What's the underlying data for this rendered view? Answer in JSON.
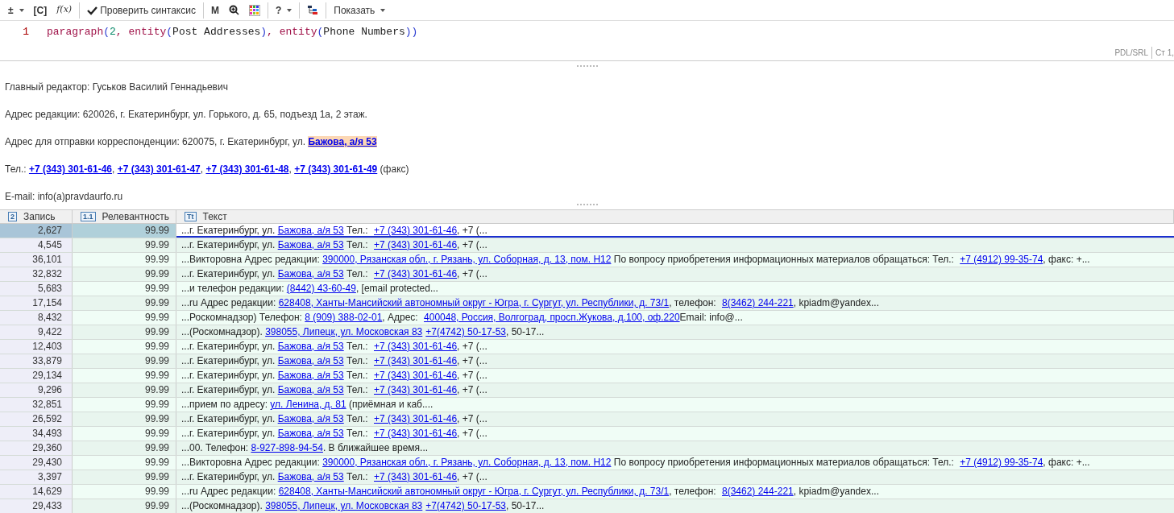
{
  "toolbar": [
    {
      "kind": "text",
      "label": "±",
      "caret": true
    },
    {
      "kind": "text",
      "label": "[C]",
      "caret": false
    },
    {
      "kind": "italic",
      "label": "f(x)",
      "caret": false
    },
    {
      "kind": "sep"
    },
    {
      "kind": "check",
      "label": "Проверить синтаксис",
      "caret": false
    },
    {
      "kind": "sep"
    },
    {
      "kind": "text",
      "label": "M",
      "caret": false
    },
    {
      "kind": "zoom",
      "caret": false
    },
    {
      "kind": "grid",
      "caret": false
    },
    {
      "kind": "sep"
    },
    {
      "kind": "text",
      "label": "?",
      "caret": true
    },
    {
      "kind": "sep"
    },
    {
      "kind": "tree",
      "caret": false
    },
    {
      "kind": "sep"
    },
    {
      "kind": "text",
      "label": "Показать",
      "caret": true
    }
  ],
  "editor": {
    "line_number": "1",
    "tokens": [
      {
        "kind": "function",
        "text": "paragraph"
      },
      {
        "kind": "paren",
        "text": "("
      },
      {
        "kind": "number",
        "text": "2"
      },
      {
        "kind": "function",
        "text": ", entity"
      },
      {
        "kind": "paren",
        "text": "("
      },
      {
        "kind": "plain",
        "text": "Post Addresses"
      },
      {
        "kind": "paren",
        "text": ")"
      },
      {
        "kind": "function",
        "text": ", entity"
      },
      {
        "kind": "paren",
        "text": "("
      },
      {
        "kind": "plain",
        "text": "Phone Numbers"
      },
      {
        "kind": "paren",
        "text": "))"
      }
    ],
    "status": [
      "PDL/SRL",
      "Ст 1,"
    ]
  },
  "preview": [
    [
      {
        "text": "Главный редактор: Гуськов Василий Геннадьевич",
        "kind": "text"
      }
    ],
    [
      {
        "text": "Адрес редакции: 620026, г. Екатеринбург, ул. Горького, д. 65, подъезд 1а, 2 этаж.",
        "kind": "text"
      }
    ],
    [
      {
        "text": "Адрес для отправки корреспонденции: 620075, г. Екатеринбург, ул. ",
        "kind": "text"
      },
      {
        "text": "Бажова, а/я 53",
        "kind": "highlight"
      }
    ],
    [
      {
        "text": "Тел.: ",
        "kind": "text"
      },
      {
        "text": "+7 (343) 301-61-46",
        "kind": "link"
      },
      {
        "text": ", ",
        "kind": "text"
      },
      {
        "text": "+7 (343) 301-61-47",
        "kind": "link"
      },
      {
        "text": ", ",
        "kind": "text"
      },
      {
        "text": "+7 (343) 301-61-48",
        "kind": "link"
      },
      {
        "text": ", ",
        "kind": "text"
      },
      {
        "text": "+7 (343) 301-61-49",
        "kind": "link"
      },
      {
        "text": " (факс)",
        "kind": "text"
      }
    ],
    [
      {
        "text": "E-mail: info(a)pravdaurfo.ru",
        "kind": "text"
      }
    ]
  ],
  "table": {
    "columns": [
      {
        "icon": "2",
        "label": "Запись"
      },
      {
        "icon": "1.1",
        "label": "Релевантность"
      },
      {
        "icon": "Tt",
        "label": "Текст"
      }
    ],
    "rows": [
      {
        "record": "2,627",
        "relevance": "99.99",
        "selected": true,
        "text": [
          {
            "text": "...г. Екатеринбург, ул. ",
            "kind": "text"
          },
          {
            "text": "Бажова, а/я 53",
            "kind": "link"
          },
          {
            "text": " Тел.: ",
            "kind": "text"
          },
          {
            "text": "+7 (343) 301-61-46",
            "kind": "link"
          },
          {
            "text": ", +7 (...",
            "kind": "text"
          }
        ]
      },
      {
        "record": "4,545",
        "relevance": "99.99",
        "selected": false,
        "text": [
          {
            "text": "...г. Екатеринбург, ул. ",
            "kind": "text"
          },
          {
            "text": "Бажова, а/я 53",
            "kind": "link"
          },
          {
            "text": " Тел.: ",
            "kind": "text"
          },
          {
            "text": "+7 (343) 301-61-46",
            "kind": "link"
          },
          {
            "text": ", +7 (...",
            "kind": "text"
          }
        ]
      },
      {
        "record": "36,101",
        "relevance": "99.99",
        "selected": false,
        "text": [
          {
            "text": "...Викторовна Адрес редакции: ",
            "kind": "text"
          },
          {
            "text": "390000, Рязанская обл., г. Рязань, ул. Соборная, д. 13, пом. Н12",
            "kind": "link"
          },
          {
            "text": " По вопросу приобретения информационных материалов обращаться: Тел.: ",
            "kind": "text"
          },
          {
            "text": "+7 (4912) 99-35-74",
            "kind": "link"
          },
          {
            "text": ", факс: +...",
            "kind": "text"
          }
        ]
      },
      {
        "record": "32,832",
        "relevance": "99.99",
        "selected": false,
        "text": [
          {
            "text": "...г. Екатеринбург, ул. ",
            "kind": "text"
          },
          {
            "text": "Бажова, а/я 53",
            "kind": "link"
          },
          {
            "text": " Тел.: ",
            "kind": "text"
          },
          {
            "text": "+7 (343) 301-61-46",
            "kind": "link"
          },
          {
            "text": ", +7 (...",
            "kind": "text"
          }
        ]
      },
      {
        "record": "5,683",
        "relevance": "99.99",
        "selected": false,
        "text": [
          {
            "text": "...и телефон редакции: ",
            "kind": "text"
          },
          {
            "text": "(8442) 43-60-49",
            "kind": "link"
          },
          {
            "text": ", [email protected...",
            "kind": "text"
          }
        ]
      },
      {
        "record": "17,154",
        "relevance": "99.99",
        "selected": false,
        "text": [
          {
            "text": "...ru Адрес редакции: ",
            "kind": "text"
          },
          {
            "text": "628408, Ханты-Мансийский автономный округ - Югра, г. Сургут, ул. Республики, д. 73/1",
            "kind": "link"
          },
          {
            "text": ", телефон: ",
            "kind": "text"
          },
          {
            "text": "8(3462) 244-221",
            "kind": "link"
          },
          {
            "text": ", kpiadm@yandex...",
            "kind": "text"
          }
        ]
      },
      {
        "record": "8,432",
        "relevance": "99.99",
        "selected": false,
        "text": [
          {
            "text": "...Роскомнадзор) Телефон: ",
            "kind": "text"
          },
          {
            "text": "8 (909) 388-02-01",
            "kind": "link"
          },
          {
            "text": ", Адрес: ",
            "kind": "text"
          },
          {
            "text": "400048, Россия, Волгоград, просп.Жукова, д.100, оф.220",
            "kind": "link"
          },
          {
            "text": "Email: info@...",
            "kind": "text"
          }
        ]
      },
      {
        "record": "9,422",
        "relevance": "99.99",
        "selected": false,
        "text": [
          {
            "text": "...(Роскомнадзор). ",
            "kind": "text"
          },
          {
            "text": "398055, Липецк, ул. Московская 83",
            "kind": "link"
          },
          {
            "text": "+7(4742) 50-17-53",
            "kind": "link"
          },
          {
            "text": ", 50-17...",
            "kind": "text"
          }
        ]
      },
      {
        "record": "12,403",
        "relevance": "99.99",
        "selected": false,
        "text": [
          {
            "text": "...г. Екатеринбург, ул. ",
            "kind": "text"
          },
          {
            "text": "Бажова, а/я 53",
            "kind": "link"
          },
          {
            "text": " Тел.: ",
            "kind": "text"
          },
          {
            "text": "+7 (343) 301-61-46",
            "kind": "link"
          },
          {
            "text": ", +7 (...",
            "kind": "text"
          }
        ]
      },
      {
        "record": "33,879",
        "relevance": "99.99",
        "selected": false,
        "text": [
          {
            "text": "...г. Екатеринбург, ул. ",
            "kind": "text"
          },
          {
            "text": "Бажова, а/я 53",
            "kind": "link"
          },
          {
            "text": " Тел.: ",
            "kind": "text"
          },
          {
            "text": "+7 (343) 301-61-46",
            "kind": "link"
          },
          {
            "text": ", +7 (...",
            "kind": "text"
          }
        ]
      },
      {
        "record": "29,134",
        "relevance": "99.99",
        "selected": false,
        "text": [
          {
            "text": "...г. Екатеринбург, ул. ",
            "kind": "text"
          },
          {
            "text": "Бажова, а/я 53",
            "kind": "link"
          },
          {
            "text": " Тел.: ",
            "kind": "text"
          },
          {
            "text": "+7 (343) 301-61-46",
            "kind": "link"
          },
          {
            "text": ", +7 (...",
            "kind": "text"
          }
        ]
      },
      {
        "record": "9,296",
        "relevance": "99.99",
        "selected": false,
        "text": [
          {
            "text": "...г. Екатеринбург, ул. ",
            "kind": "text"
          },
          {
            "text": "Бажова, а/я 53",
            "kind": "link"
          },
          {
            "text": " Тел.: ",
            "kind": "text"
          },
          {
            "text": "+7 (343) 301-61-46",
            "kind": "link"
          },
          {
            "text": ", +7 (...",
            "kind": "text"
          }
        ]
      },
      {
        "record": "32,851",
        "relevance": "99.99",
        "selected": false,
        "text": [
          {
            "text": "...прием по адресу: ",
            "kind": "text"
          },
          {
            "text": "ул. Ленина, д. 81",
            "kind": "link"
          },
          {
            "text": " (приёмная и каб....",
            "kind": "text"
          }
        ]
      },
      {
        "record": "26,592",
        "relevance": "99.99",
        "selected": false,
        "text": [
          {
            "text": "...г. Екатеринбург, ул. ",
            "kind": "text"
          },
          {
            "text": "Бажова, а/я 53",
            "kind": "link"
          },
          {
            "text": " Тел.: ",
            "kind": "text"
          },
          {
            "text": "+7 (343) 301-61-46",
            "kind": "link"
          },
          {
            "text": ", +7 (...",
            "kind": "text"
          }
        ]
      },
      {
        "record": "34,493",
        "relevance": "99.99",
        "selected": false,
        "text": [
          {
            "text": "...г. Екатеринбург, ул. ",
            "kind": "text"
          },
          {
            "text": "Бажова, а/я 53",
            "kind": "link"
          },
          {
            "text": " Тел.: ",
            "kind": "text"
          },
          {
            "text": "+7 (343) 301-61-46",
            "kind": "link"
          },
          {
            "text": ", +7 (...",
            "kind": "text"
          }
        ]
      },
      {
        "record": "29,360",
        "relevance": "99.99",
        "selected": false,
        "text": [
          {
            "text": "...00. Телефон: ",
            "kind": "text"
          },
          {
            "text": "8-927-898-94-54",
            "kind": "link"
          },
          {
            "text": ". В ближайшее время...",
            "kind": "text"
          }
        ]
      },
      {
        "record": "29,430",
        "relevance": "99.99",
        "selected": false,
        "text": [
          {
            "text": "...Викторовна Адрес редакции: ",
            "kind": "text"
          },
          {
            "text": "390000, Рязанская обл., г. Рязань, ул. Соборная, д. 13, пом. Н12",
            "kind": "link"
          },
          {
            "text": " По вопросу приобретения информационных материалов обращаться: Тел.: ",
            "kind": "text"
          },
          {
            "text": "+7 (4912) 99-35-74",
            "kind": "link"
          },
          {
            "text": ", факс: +...",
            "kind": "text"
          }
        ]
      },
      {
        "record": "3,397",
        "relevance": "99.99",
        "selected": false,
        "text": [
          {
            "text": "...г. Екатеринбург, ул. ",
            "kind": "text"
          },
          {
            "text": "Бажова, а/я 53",
            "kind": "link"
          },
          {
            "text": " Тел.: ",
            "kind": "text"
          },
          {
            "text": "+7 (343) 301-61-46",
            "kind": "link"
          },
          {
            "text": ", +7 (...",
            "kind": "text"
          }
        ]
      },
      {
        "record": "14,629",
        "relevance": "99.99",
        "selected": false,
        "text": [
          {
            "text": "...ru Адрес редакции: ",
            "kind": "text"
          },
          {
            "text": "628408, Ханты-Мансийский автономный округ - Югра, г. Сургут, ул. Республики, д. 73/1",
            "kind": "link"
          },
          {
            "text": ", телефон: ",
            "kind": "text"
          },
          {
            "text": "8(3462) 244-221",
            "kind": "link"
          },
          {
            "text": ", kpiadm@yandex...",
            "kind": "text"
          }
        ]
      },
      {
        "record": "29,433",
        "relevance": "99.99",
        "selected": false,
        "text": [
          {
            "text": "...(Роскомнадзор). ",
            "kind": "text"
          },
          {
            "text": "398055, Липецк, ул. Московская 83",
            "kind": "link"
          },
          {
            "text": "+7(4742) 50-17-53",
            "kind": "link"
          },
          {
            "text": ", 50-17...",
            "kind": "text"
          }
        ]
      }
    ]
  }
}
